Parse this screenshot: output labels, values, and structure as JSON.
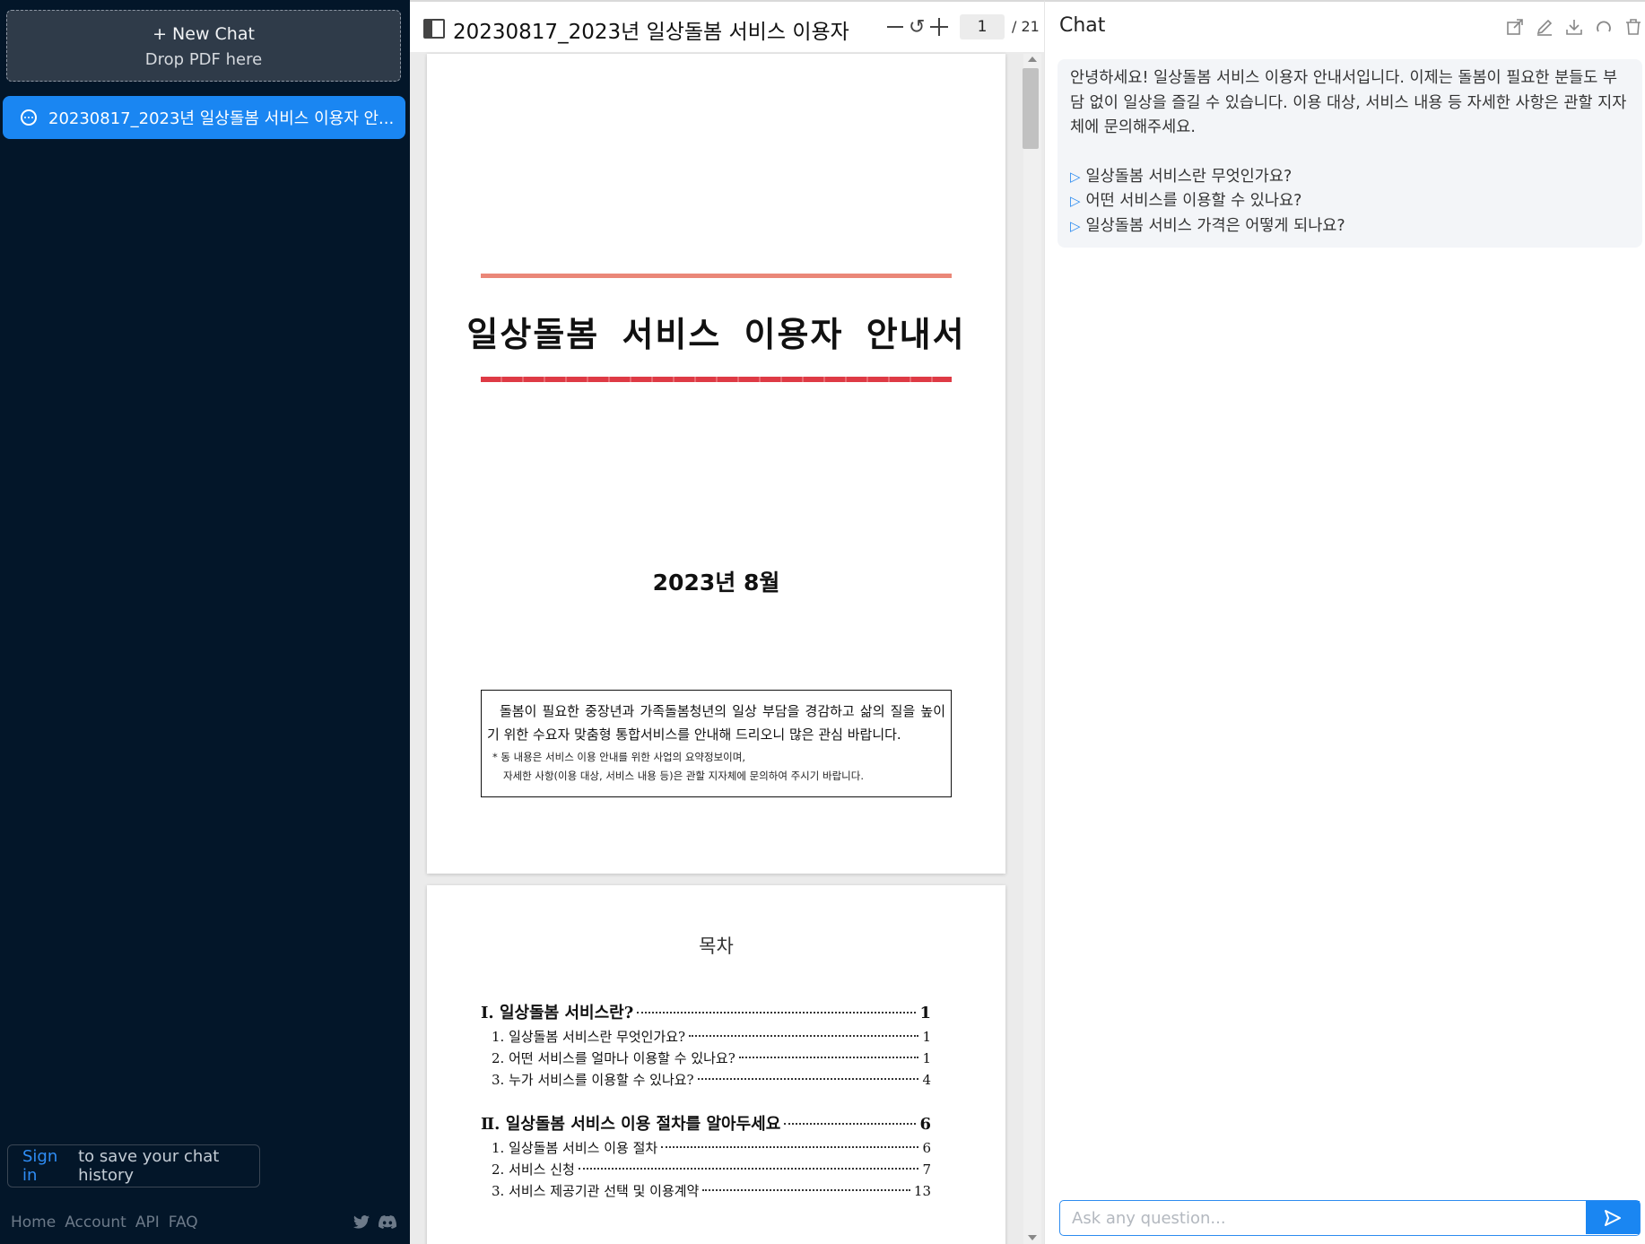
{
  "sidebar": {
    "new_chat_label": "+ New Chat",
    "drop_label": "Drop PDF here",
    "chat_items": [
      {
        "label": "20230817_2023년 일상돌봄 서비스 이용자 안..."
      }
    ],
    "signin_link": "Sign in",
    "signin_text": "to save your chat history",
    "footer_links": [
      "Home",
      "Account",
      "API",
      "FAQ"
    ],
    "social_icons": [
      "twitter-icon",
      "discord-icon"
    ]
  },
  "viewer": {
    "title": "20230817_2023년 일상돌봄 서비스 이용자 ...",
    "page_current": "1",
    "page_total": "/ 21",
    "page1": {
      "title": "일상돌봄 서비스 이용자 안내서",
      "date": "2023년 8월",
      "box_main": "돌봄이 필요한 중장년과 가족돌봄청년의 일상 부담을 경감하고 삶의 질을 높이기 위한 수요자 맞춤형 통합서비스를 안내해 드리오니 많은 관심 바랍니다.",
      "box_note1": "* 동 내용은 서비스 이용 안내를 위한 사업의 요약정보이며,",
      "box_note2": "자세한 사항(이용 대상, 서비스 내용 등)은 관할 지자체에 문의하여 주시기 바랍니다."
    },
    "page2": {
      "toc_title": "목차",
      "toc": [
        {
          "label": "Ⅰ. 일상돌봄 서비스란?",
          "page": "1",
          "level": "sec"
        },
        {
          "label": "1. 일상돌봄 서비스란 무엇인가요?",
          "page": "1",
          "level": "sub"
        },
        {
          "label": "2. 어떤 서비스를 얼마나 이용할 수 있나요?",
          "page": "1",
          "level": "sub"
        },
        {
          "label": "3. 누가 서비스를 이용할 수 있나요?",
          "page": "4",
          "level": "sub"
        },
        {
          "label": "Ⅱ. 일상돌봄 서비스 이용 절차를 알아두세요",
          "page": "6",
          "level": "sec"
        },
        {
          "label": "1. 일상돌봄 서비스 이용 절차",
          "page": "6",
          "level": "sub"
        },
        {
          "label": "2. 서비스 신청",
          "page": "7",
          "level": "sub"
        },
        {
          "label": "3. 서비스 제공기관 선택 및 이용계약",
          "page": "13",
          "level": "sub"
        }
      ]
    }
  },
  "chat": {
    "title": "Chat",
    "tools": [
      "share-icon",
      "edit-icon",
      "download-icon",
      "refresh-icon",
      "trash-icon"
    ],
    "intro": "안녕하세요! 일상돌봄 서비스 이용자 안내서입니다. 이제는 돌봄이 필요한 분들도 부담 없이 일상을 즐길 수 있습니다. 이용 대상, 서비스 내용 등 자세한 사항은 관할 지자체에 문의해주세요.",
    "suggestions": [
      "일상돌봄 서비스란 무엇인가요?",
      "어떤 서비스를 이용할 수 있나요?",
      "일상돌봄 서비스 가격은 어떻게 되나요?"
    ],
    "input_placeholder": "Ask any question..."
  },
  "colors": {
    "sidebar_bg": "#031629",
    "accent": "#1a86f2",
    "title_rule_top": "#ea8778",
    "title_rule_bottom": "#de3a45"
  }
}
